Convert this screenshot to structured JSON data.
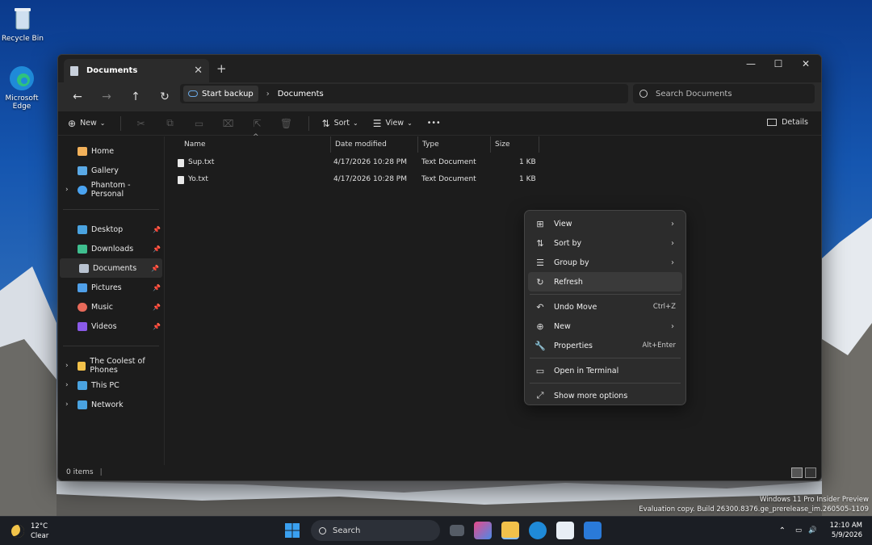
{
  "desktop": {
    "icons": [
      {
        "label": "Recycle Bin",
        "icon": "recycle-bin-icon"
      },
      {
        "label": "Microsoft Edge",
        "icon": "edge-icon"
      }
    ],
    "watermark_line1": "Windows 11 Pro Insider Preview",
    "watermark_line2": "Evaluation copy. Build 26300.8376.ge_prerelease_im.260505-1109"
  },
  "window": {
    "tab_title": "Documents",
    "new_tab": "+",
    "controls": {
      "minimize": "—",
      "maximize": "☐",
      "close": "✕"
    }
  },
  "address": {
    "backup_label": "Start backup",
    "crumb": "Documents",
    "search_placeholder": "Search Documents"
  },
  "toolbar": {
    "new_label": "New",
    "sort_label": "Sort",
    "view_label": "View",
    "more_label": "•••",
    "details_label": "Details"
  },
  "sidebar": {
    "top": [
      {
        "label": "Home",
        "icon": "home-icon",
        "color": "#f2b15a"
      },
      {
        "label": "Gallery",
        "icon": "gallery-icon",
        "color": "#5aa9e6"
      },
      {
        "label": "Phantom - Personal",
        "icon": "onedrive-icon",
        "color": "#4aa3f0"
      }
    ],
    "pinned": [
      {
        "label": "Desktop",
        "icon": "desktop-icon",
        "color": "#4aa3e0"
      },
      {
        "label": "Downloads",
        "icon": "downloads-icon",
        "color": "#3fbf8f"
      },
      {
        "label": "Documents",
        "icon": "documents-icon",
        "color": "#b8c2d0"
      },
      {
        "label": "Pictures",
        "icon": "pictures-icon",
        "color": "#4f9fe8"
      },
      {
        "label": "Music",
        "icon": "music-icon",
        "color": "#e86a5a"
      },
      {
        "label": "Videos",
        "icon": "videos-icon",
        "color": "#8a5ae8"
      }
    ],
    "bottom": [
      {
        "label": "The Coolest of Phones",
        "icon": "folder-icon",
        "color": "#f2c14a"
      },
      {
        "label": "This PC",
        "icon": "this-pc-icon",
        "color": "#4aa3e0"
      },
      {
        "label": "Network",
        "icon": "network-icon",
        "color": "#4aa3e0"
      }
    ]
  },
  "files": {
    "columns": [
      "Name",
      "Date modified",
      "Type",
      "Size"
    ],
    "rows": [
      {
        "name": "Sup.txt",
        "date": "4/17/2026 10:28 PM",
        "type": "Text Document",
        "size": "1 KB"
      },
      {
        "name": "Yo.txt",
        "date": "4/17/2026 10:28 PM",
        "type": "Text Document",
        "size": "1 KB"
      }
    ]
  },
  "status": {
    "items": "0 items"
  },
  "context_menu": {
    "view": "View",
    "sort_by": "Sort by",
    "group_by": "Group by",
    "refresh": "Refresh",
    "undo_move": "Undo Move",
    "undo_shortcut": "Ctrl+Z",
    "new": "New",
    "properties": "Properties",
    "properties_shortcut": "Alt+Enter",
    "open_terminal": "Open in Terminal",
    "show_more": "Show more options"
  },
  "taskbar": {
    "temp": "12°C",
    "condition": "Clear",
    "search_label": "Search",
    "time": "12:10 AM",
    "date": "5/9/2026"
  }
}
